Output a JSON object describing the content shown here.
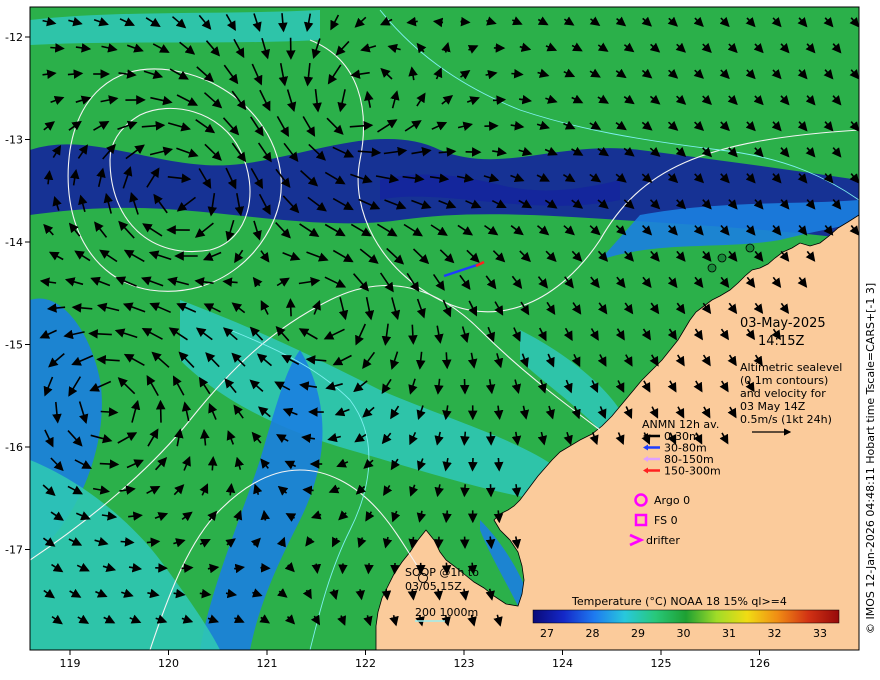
{
  "map": {
    "date": "03-May-2025",
    "time": "14:15Z",
    "altimetry_lines": [
      "Altimetric sealevel",
      "(0.1m contours)",
      "and velocity for",
      "03 May 14Z",
      "0.5m/s (1kt 24h)"
    ],
    "legend": {
      "title": "ANMN 12h av.",
      "items": [
        {
          "label": "0-30m",
          "color": "#000000"
        },
        {
          "label": "30-80m",
          "color": "#1e3cff"
        },
        {
          "label": "80-150m",
          "color": "#e0a0ff"
        },
        {
          "label": "150-300m",
          "color": "#ff2020"
        }
      ],
      "argo": "Argo 0",
      "fs": "FS 0",
      "drifter": "drifter",
      "marker_color": "#ff00ff"
    },
    "soop": [
      "SOOP @1h to",
      "03/05 15Z"
    ],
    "depth_label": "200  1000m",
    "colorbar": {
      "title": "Temperature (°C) NOAA 18 15% ql>=4",
      "ticks": [
        "27",
        "28",
        "29",
        "30",
        "31",
        "32",
        "33"
      ],
      "stops": [
        "#0a0a78",
        "#1428c8",
        "#1e7af0",
        "#28c8dc",
        "#28c87a",
        "#1ea032",
        "#a0dc28",
        "#f0dc14",
        "#f08c14",
        "#d23214",
        "#960a0a"
      ]
    },
    "lon_ticks": [
      "119",
      "120",
      "121",
      "122",
      "123",
      "124",
      "125",
      "126"
    ],
    "lat_ticks": [
      "-12",
      "-13",
      "-14",
      "-15",
      "-16",
      "-17"
    ],
    "copyright": "© IMOS 12-Jan-2026 04:48:11 Hobart time Tscale=CARS+[-1 3]",
    "colors": {
      "land": "#fbcb9b",
      "sea_green": "#2bb04a",
      "sea_cyan": "#2fc6b4",
      "sea_blue": "#1b7fe0",
      "sea_deep": "#14259c"
    }
  }
}
